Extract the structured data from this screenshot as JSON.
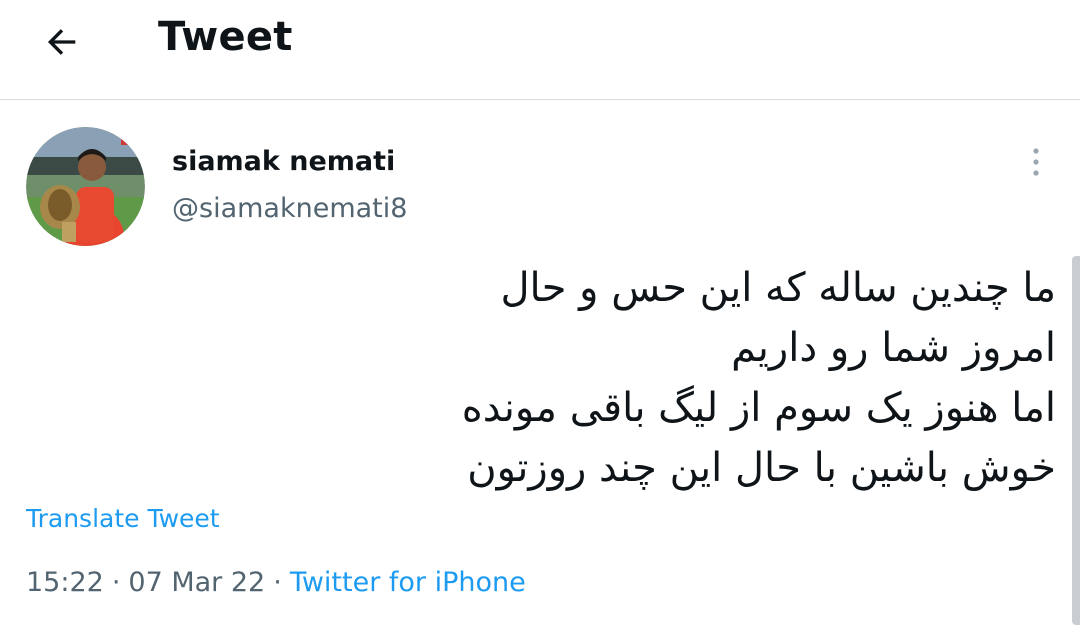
{
  "header": {
    "title": "Tweet",
    "back_icon": "arrow-left-icon"
  },
  "author": {
    "display_name": "siamak nemati",
    "handle": "@siamaknemati8",
    "avatar_icon": "user-avatar"
  },
  "tweet": {
    "lines": [
      "ما چندین ساله که این حس و حال",
      "امروز شما رو داریم",
      "اما هنوز یک سوم از لیگ باقی مونده",
      "خوش باشین با حال این چند روزتون"
    ],
    "translate_label": "Translate Tweet",
    "time": "15:22",
    "date": "07 Mar 22",
    "separator": "·",
    "source": "Twitter for iPhone"
  },
  "colors": {
    "link": "#1d9bf0",
    "text": "#0f1419",
    "secondary": "#536471",
    "divider": "#d9dde0"
  }
}
